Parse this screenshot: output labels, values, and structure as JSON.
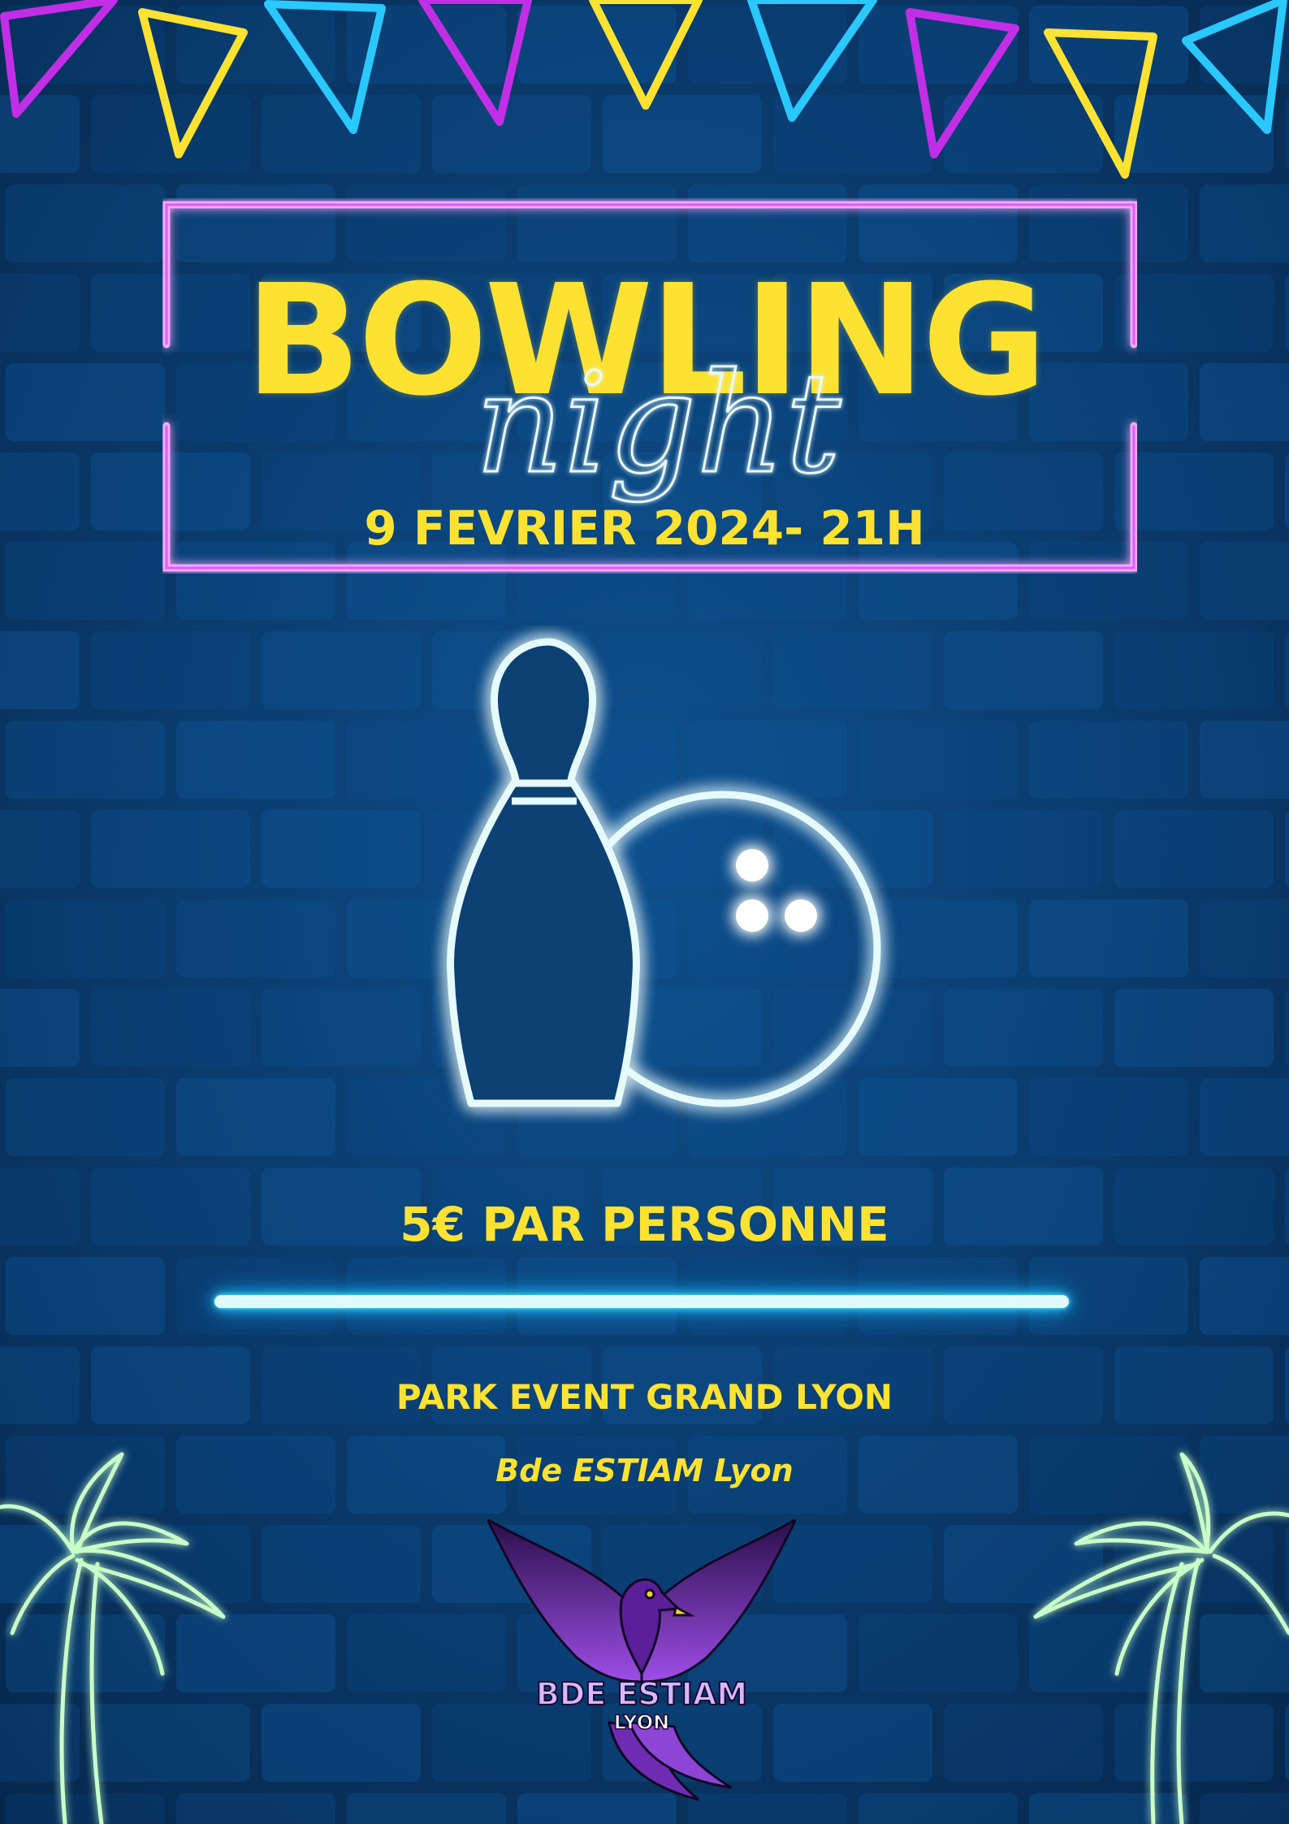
{
  "poster": {
    "title": "BOWLING",
    "subtitle": "night",
    "date": "9 FEVRIER 2024- 21H",
    "price": "5€ PAR PERSONNE",
    "venue": "PARK EVENT GRAND LYON",
    "organizer": "Bde ESTIAM Lyon"
  },
  "logo": {
    "line1": "BDE ESTIAM",
    "line2": "LYON"
  },
  "icons": {
    "bowling": "bowling-pin-and-ball-icon",
    "bunting": "party-bunting-icon",
    "palm": "palm-tree-icon",
    "logo": "phoenix-icon"
  },
  "colors": {
    "background": "#0b3f73",
    "accent_yellow": "#fde232",
    "neon_magenta": "#d63bff",
    "neon_cyan": "#29c8ff",
    "neon_green": "#38ff4a",
    "logo_purple": "#7a2ec0"
  }
}
